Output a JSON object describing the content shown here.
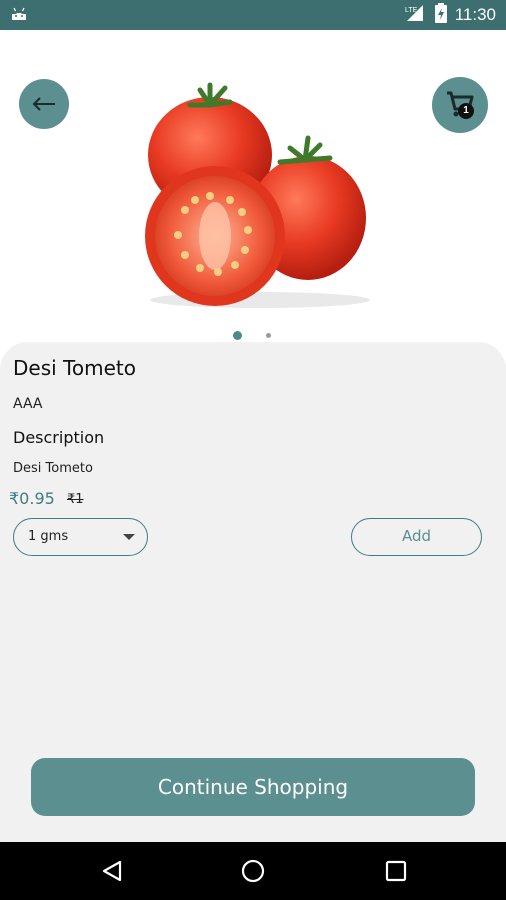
{
  "status_bar": {
    "time": "11:30",
    "network_label": "LTE",
    "icons": [
      "android-icon",
      "lte-signal-icon",
      "battery-charging-icon"
    ]
  },
  "header": {
    "back_icon": "arrow-left-icon",
    "cart_icon": "cart-icon",
    "cart_count": "1"
  },
  "gallery": {
    "image": "tomato-image",
    "slides": 2,
    "active_slide": 1
  },
  "product": {
    "name": "Desi Tometo",
    "brand": "AAA",
    "description_heading": "Description",
    "description": "Desi Tometo",
    "price": "₹0.95",
    "mrp": "₹1",
    "quantity_option": "1 gms",
    "add_label": "Add"
  },
  "footer": {
    "continue_label": "Continue Shopping"
  },
  "colors": {
    "status_bar": "#3d6f70",
    "accent": "#5b8f90",
    "price": "#3f7e80",
    "panel_bg": "#f1f1f1"
  },
  "nav_bar": {
    "icons": [
      "back-triangle-icon",
      "home-circle-icon",
      "recents-square-icon"
    ]
  }
}
